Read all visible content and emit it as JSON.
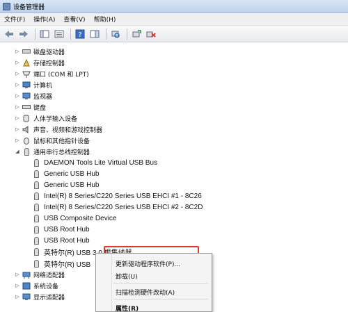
{
  "window": {
    "title": "设备管理器"
  },
  "menubar": {
    "items": [
      "文件(F)",
      "操作(A)",
      "查看(V)",
      "帮助(H)"
    ]
  },
  "tree": {
    "categories": [
      {
        "label": "磁盘驱动器",
        "expanded": false
      },
      {
        "label": "存储控制器",
        "expanded": false
      },
      {
        "label": "端口 (COM 和 LPT)",
        "expanded": false
      },
      {
        "label": "计算机",
        "expanded": false
      },
      {
        "label": "监视器",
        "expanded": false
      },
      {
        "label": "键盘",
        "expanded": false
      },
      {
        "label": "人体学输入设备",
        "expanded": false
      },
      {
        "label": "声音、视频和游戏控制器",
        "expanded": false
      },
      {
        "label": "鼠标和其他指针设备",
        "expanded": false
      },
      {
        "label": "通用串行总线控制器",
        "expanded": true
      }
    ],
    "usb_children": [
      "DAEMON Tools Lite Virtual USB Bus",
      "Generic USB Hub",
      "Generic USB Hub",
      "Intel(R) 8 Series/C220 Series USB EHCI #1 - 8C26",
      "Intel(R) 8 Series/C220 Series USB EHCI #2 - 8C2D",
      "USB Composite Device",
      "USB Root Hub",
      "USB Root Hub",
      "英特尔(R) USB 3.0 根集线器",
      "英特尔(R) USB"
    ],
    "after": [
      {
        "label": "网络适配器",
        "expanded": false
      },
      {
        "label": "系统设备",
        "expanded": false
      },
      {
        "label": "显示适配器",
        "expanded": false
      }
    ]
  },
  "context_menu": {
    "items": [
      "更新驱动程序软件(P)...",
      "卸载(U)",
      "扫描检测硬件改动(A)",
      "属性(R)"
    ]
  },
  "colors": {
    "highlight": "#d63c34"
  }
}
